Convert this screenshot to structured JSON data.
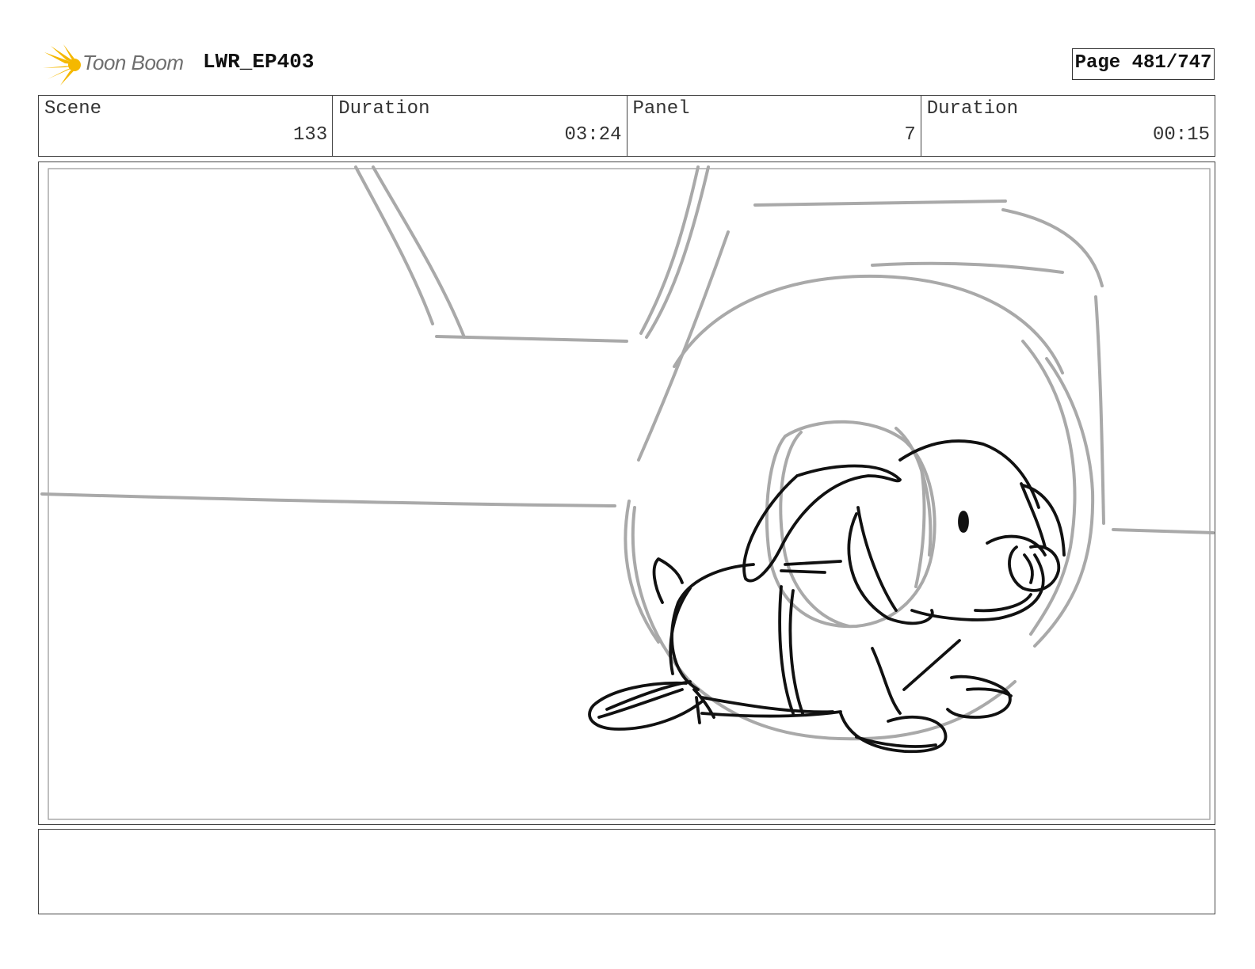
{
  "header": {
    "logo_text": "Toon Boom",
    "project": "LWR_EP403",
    "page": "Page 481/747"
  },
  "info": {
    "scene_label": "Scene",
    "scene_value": "133",
    "duration_label": "Duration",
    "duration_value": "03:24",
    "panel_label": "Panel",
    "panel_value": "7",
    "panel_duration_label": "Duration",
    "panel_duration_value": "00:15"
  },
  "notes": {
    "text": ""
  },
  "colors": {
    "sketch_gray": "#a9a9a9",
    "sketch_black": "#111111",
    "logo_yellow": "#f5b800"
  }
}
